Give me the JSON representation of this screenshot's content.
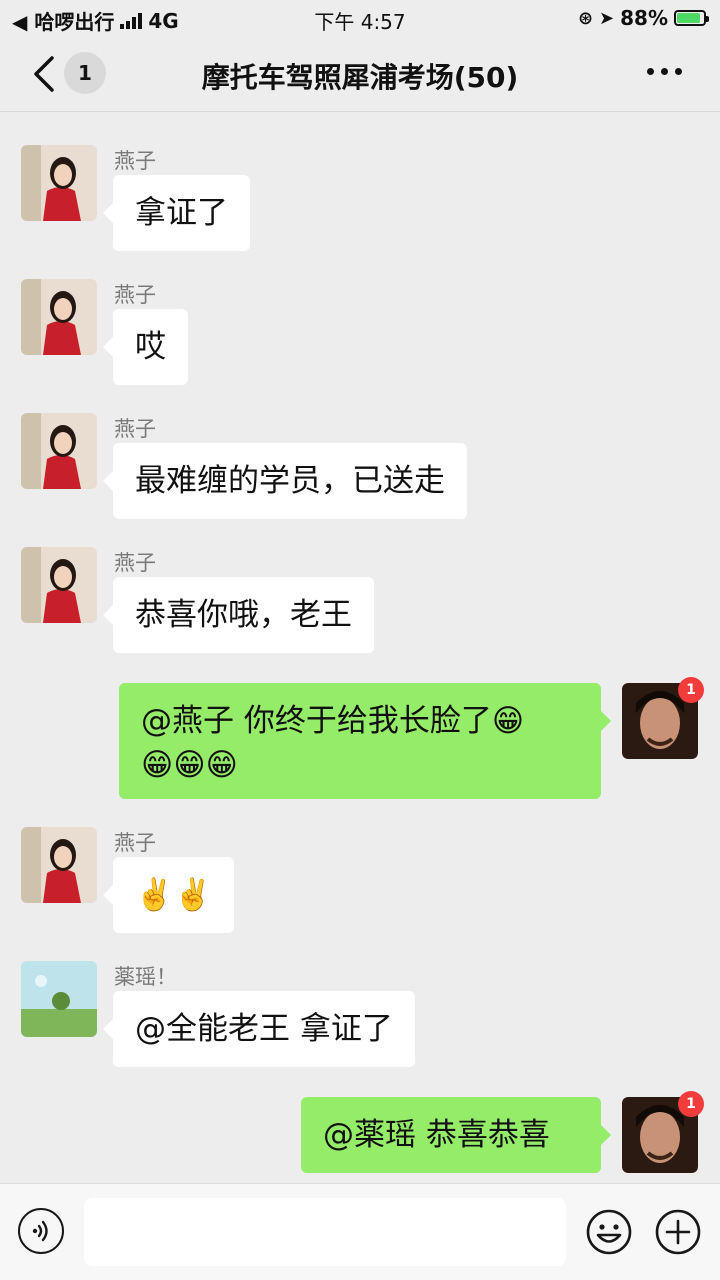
{
  "status_bar": {
    "carrier_back": "◀ 哈啰出行",
    "network": "4G",
    "time": "下午 4:57",
    "battery_percent": "88%",
    "battery_level": 0.88
  },
  "header": {
    "unread_count": "1",
    "title": "摩托车驾照犀浦考场(50)"
  },
  "messages": [
    {
      "side": "in",
      "sender": "燕子",
      "text": "拿证了"
    },
    {
      "side": "in",
      "sender": "燕子",
      "text": "哎"
    },
    {
      "side": "in",
      "sender": "燕子",
      "text": "最难缠的学员，已送走"
    },
    {
      "side": "in",
      "sender": "燕子",
      "text": "恭喜你哦，老王"
    },
    {
      "side": "out",
      "text": "@燕子 你终于给我长脸了😁\n😁😁😁",
      "badge": "1"
    },
    {
      "side": "in",
      "sender": "燕子",
      "text": "✌️✌️"
    },
    {
      "side": "in",
      "sender": "薬瑶！",
      "text": "@全能老王 拿证了"
    },
    {
      "side": "out",
      "text": "@薬瑶 恭喜恭喜",
      "badge": "1"
    }
  ],
  "input_bar": {
    "placeholder": ""
  },
  "colors": {
    "background": "#ededed",
    "outgoing_bubble": "#95ec69",
    "incoming_bubble": "#ffffff",
    "badge": "#f23c3c"
  },
  "icons": [
    "back-icon",
    "more-icon",
    "voice-icon",
    "emoji-icon",
    "plus-icon"
  ]
}
